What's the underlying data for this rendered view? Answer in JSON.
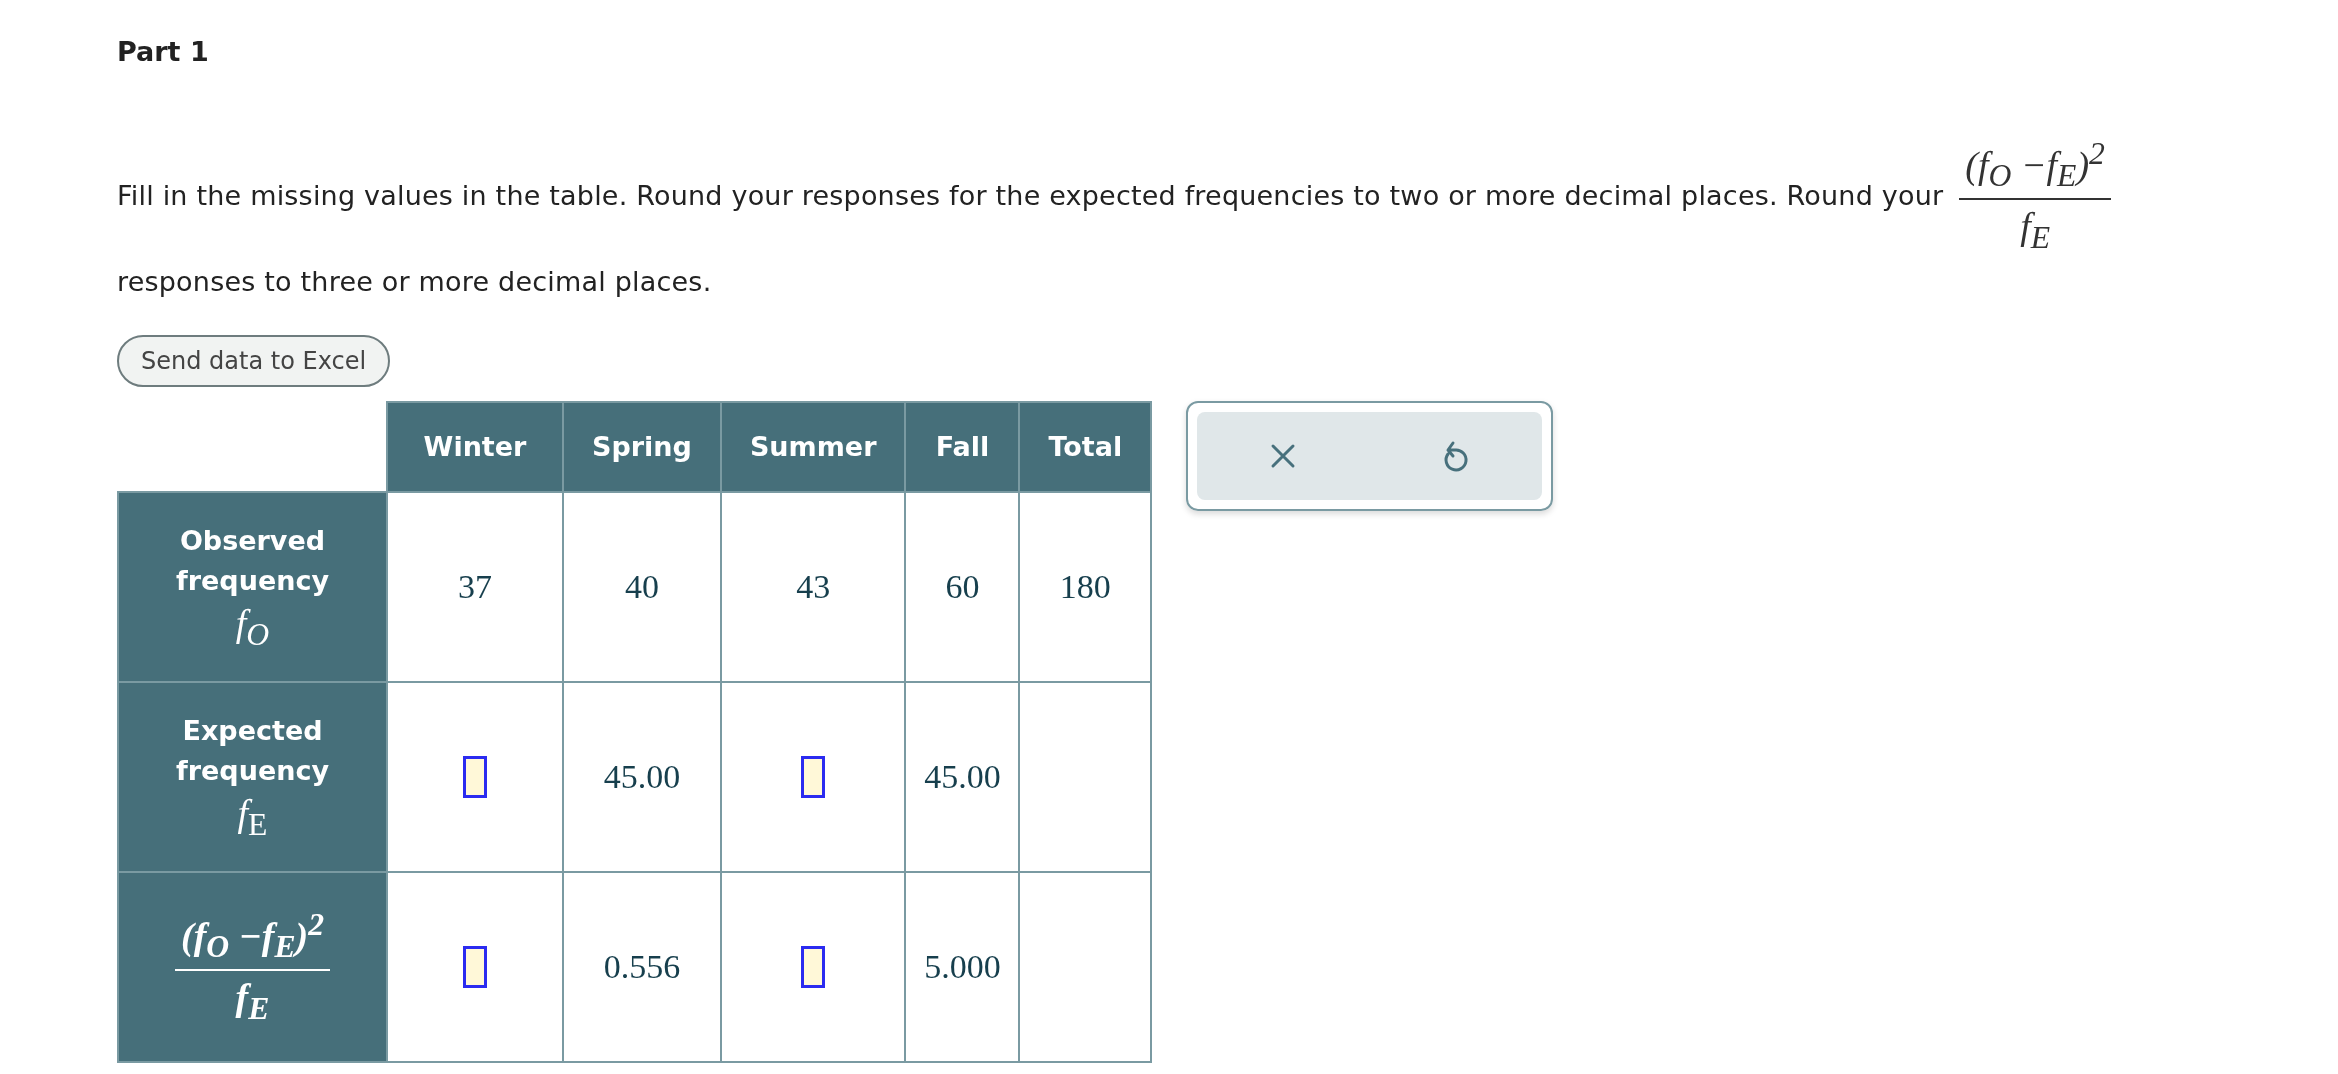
{
  "part_title": "Part 1",
  "instructions": {
    "text_before": "Fill in the missing values in the table. Round your responses for the expected frequencies to two or more decimal places. Round your",
    "formula": {
      "numerator": "(f$_{O}$ −f$_{E}$)$^{2}$",
      "denominator": "f$_{E}$"
    },
    "text_after": "responses to three or more decimal places."
  },
  "excel_button": "Send data to Excel",
  "table": {
    "columns": [
      "Winter",
      "Spring",
      "Summer",
      "Fall",
      "Total"
    ],
    "rows": [
      {
        "label": "Observed frequency",
        "symbol": {
          "kind": "symbol",
          "text": "f$_{O}$"
        },
        "cells": [
          {
            "kind": "value",
            "text": "37"
          },
          {
            "kind": "value",
            "text": "40"
          },
          {
            "kind": "value",
            "text": "43"
          },
          {
            "kind": "value",
            "text": "60"
          },
          {
            "kind": "value",
            "text": "180"
          }
        ]
      },
      {
        "label": "Expected frequency",
        "symbol": {
          "kind": "symbol",
          "text": "f$_{E}$"
        },
        "cells": [
          {
            "kind": "input"
          },
          {
            "kind": "value",
            "text": "45.00"
          },
          {
            "kind": "input"
          },
          {
            "kind": "value",
            "text": "45.00"
          },
          {
            "kind": "empty"
          }
        ]
      },
      {
        "symbol": {
          "kind": "fraction",
          "numerator": "(f$_{O}$ −f$_{E}$)$^{2}$",
          "denominator": "f$_{E}$"
        },
        "cells": [
          {
            "kind": "input"
          },
          {
            "kind": "value",
            "text": "0.556"
          },
          {
            "kind": "input"
          },
          {
            "kind": "value",
            "text": "5.000"
          },
          {
            "kind": "empty"
          }
        ]
      }
    ]
  },
  "answer_tools": [
    {
      "kind": "clear"
    },
    {
      "kind": "undo"
    }
  ]
}
